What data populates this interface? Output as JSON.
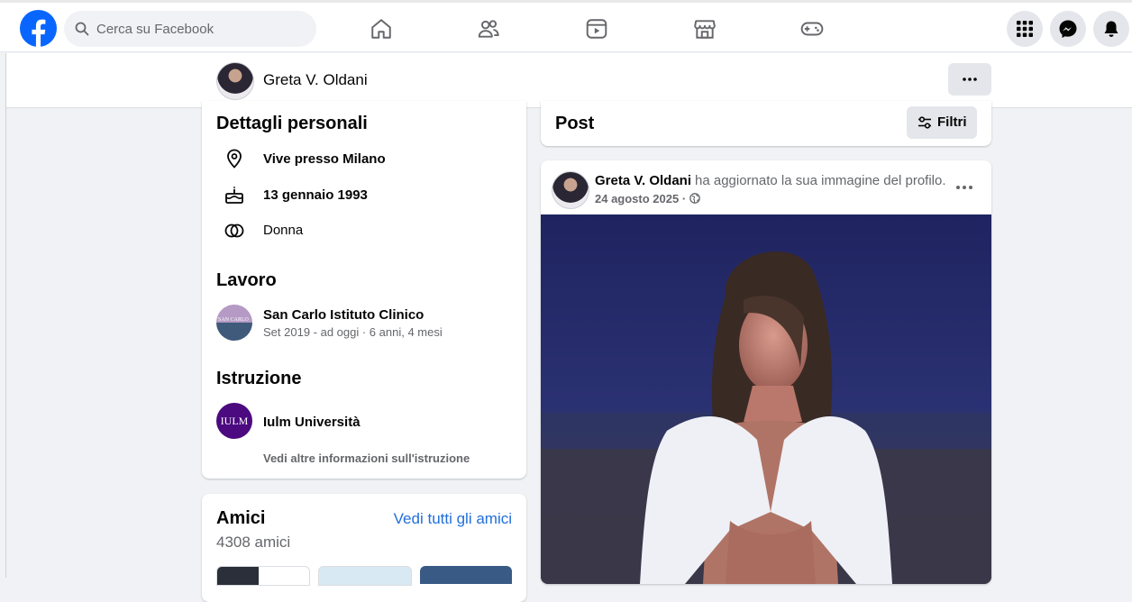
{
  "colors": {
    "brand": "#0866ff",
    "link": "#216fdb",
    "muted": "#65676b"
  },
  "topbar": {
    "search_placeholder": "Cerca su Facebook",
    "nav_icons": [
      "home-icon",
      "friends-icon",
      "video-icon",
      "marketplace-icon",
      "gaming-icon"
    ],
    "right_icons": [
      "menu-grid-icon",
      "messenger-icon",
      "notifications-icon"
    ]
  },
  "profile": {
    "name": "Greta V. Oldani"
  },
  "intro": {
    "personal_title": "Dettagli personali",
    "lives_in": "Vive presso Milano",
    "birthday": "13 gennaio 1993",
    "gender": "Donna",
    "work_title": "Lavoro",
    "work_name": "San Carlo Istituto Clinico",
    "work_period": "Set 2019 - ad oggi · 6 anni, 4 mesi",
    "work_logo_text": "SAN CARLO",
    "edu_title": "Istruzione",
    "edu_name": "Iulm Università",
    "edu_logo_text": "IULM",
    "edu_more": "Vedi altre informazioni sull'istruzione"
  },
  "friends": {
    "title": "Amici",
    "see_all": "Vedi tutti gli amici",
    "count": "4308 amici"
  },
  "posts": {
    "title": "Post",
    "filter_label": "Filtri"
  },
  "post": {
    "author": "Greta V. Oldani",
    "action": "ha aggiornato la sua immagine del profilo.",
    "date": "24 agosto 2025 ·"
  }
}
